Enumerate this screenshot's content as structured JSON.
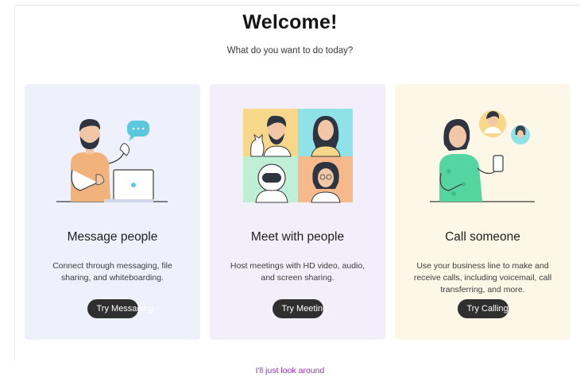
{
  "header": {
    "title": "Welcome!",
    "subtitle": "What do you want to do today?"
  },
  "cards": [
    {
      "illustration": "person-with-laptop-chat",
      "title": "Message people",
      "description": "Connect through messaging, file sharing, and whiteboarding.",
      "button": "Try Messaging",
      "background": "#eef1fc"
    },
    {
      "illustration": "video-meeting-grid",
      "title": "Meet with people",
      "description": "Host meetings with HD video, audio, and screen sharing.",
      "button": "Try Meeting",
      "background": "#f3effa"
    },
    {
      "illustration": "person-calling-phone",
      "title": "Call someone",
      "description": "Use your business line to make and receive calls, including voicemail, call transferring, and more.",
      "button": "Try Calling",
      "background": "#fcf7e6"
    }
  ],
  "footer": {
    "link": "I'll just look around"
  },
  "colors": {
    "button": "#2f2f2f",
    "link": "#9b2fc7"
  }
}
